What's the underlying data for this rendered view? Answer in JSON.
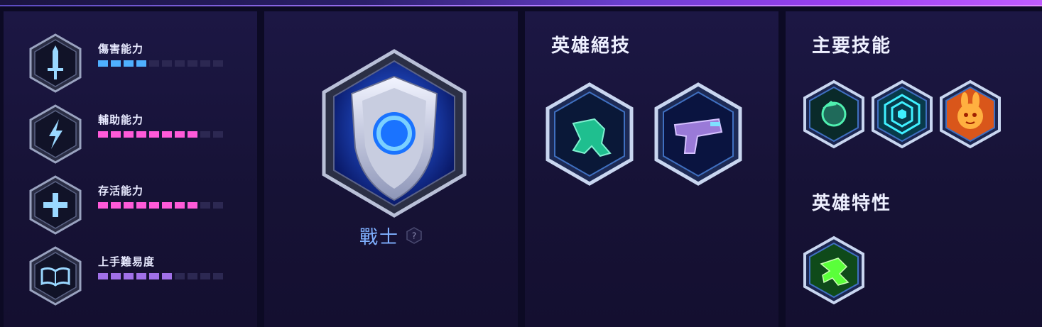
{
  "stats": [
    {
      "label": "傷害能力",
      "icon": "sword-icon",
      "level": 4,
      "max": 10,
      "color": "#4fb0ff"
    },
    {
      "label": "輔助能力",
      "icon": "lightning-icon",
      "level": 8,
      "max": 10,
      "color": "#ff5ad9"
    },
    {
      "label": "存活能力",
      "icon": "plus-icon",
      "level": 8,
      "max": 10,
      "color": "#ff5ad9"
    },
    {
      "label": "上手難易度",
      "icon": "book-icon",
      "level": 6,
      "max": 10,
      "color": "#a070e8"
    }
  ],
  "role": {
    "name": "戰士",
    "help_glyph": "?",
    "icon": "warrior-shield-icon"
  },
  "heroics": {
    "title": "英雄絕技",
    "items": [
      {
        "icon": "mech-walker-icon"
      },
      {
        "icon": "blaster-gun-icon"
      }
    ]
  },
  "abilities": {
    "title": "主要技能",
    "items": [
      {
        "icon": "boosters-icon"
      },
      {
        "icon": "defense-matrix-icon"
      },
      {
        "icon": "bunny-icon"
      }
    ]
  },
  "trait": {
    "title": "英雄特性",
    "items": [
      {
        "icon": "mech-eject-icon"
      }
    ]
  },
  "colors": {
    "accent": "#7fb0ff",
    "damage": "#4fb0ff",
    "support": "#ff5ad9",
    "difficulty": "#a070e8"
  }
}
